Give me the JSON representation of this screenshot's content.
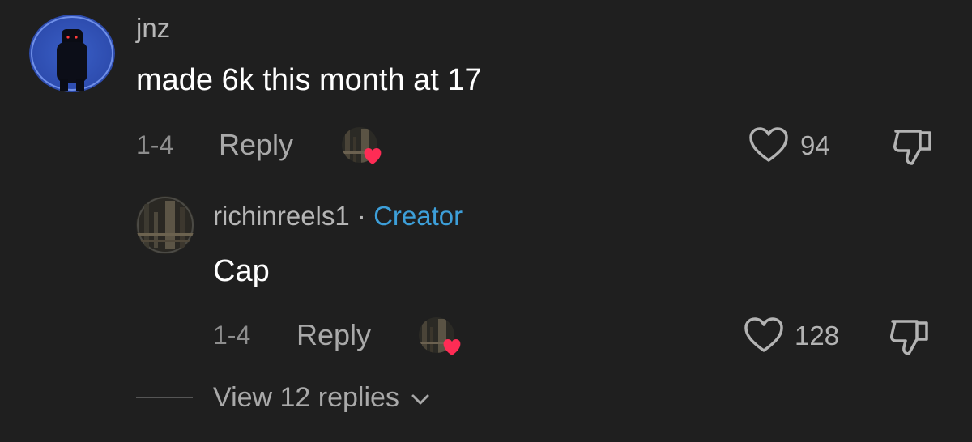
{
  "comment": {
    "username": "jnz",
    "text": "made 6k this month at 17",
    "date": "1-4",
    "reply_label": "Reply",
    "like_count": "94"
  },
  "reply": {
    "username": "richinreels1",
    "separator": " · ",
    "badge": "Creator",
    "text": "Cap",
    "date": "1-4",
    "reply_label": "Reply",
    "like_count": "128"
  },
  "thread": {
    "view_replies_label": "View 12 replies"
  },
  "colors": {
    "background": "#1f1f1f",
    "creator_badge": "#3d9fd9",
    "liked_heart": "#fe2c55"
  },
  "icons": {
    "like": "heart-outline-icon",
    "dislike": "thumbs-down-icon",
    "creator_liked": "creator-liked-heart-icon",
    "expand": "chevron-down-icon"
  }
}
